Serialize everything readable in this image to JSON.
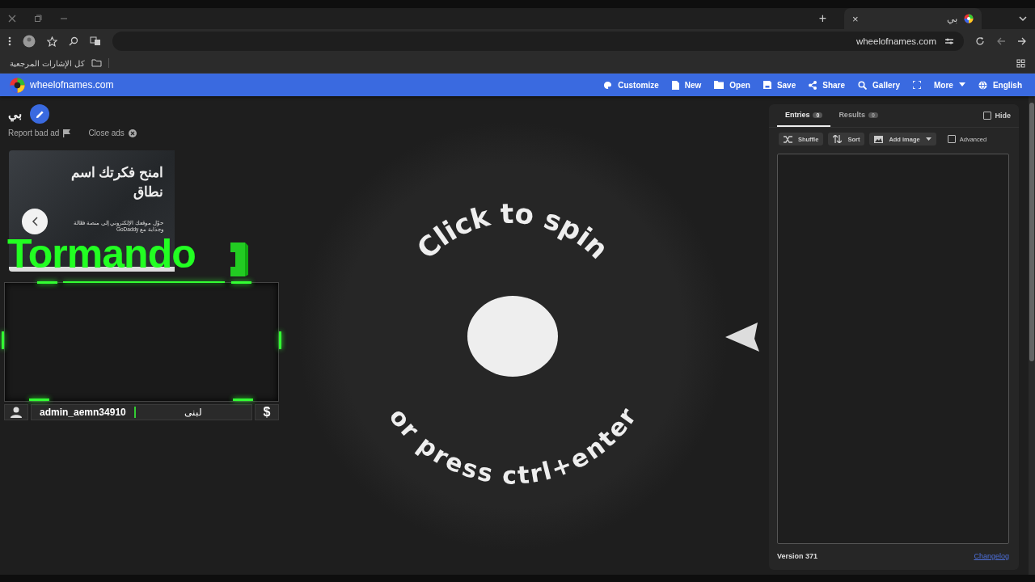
{
  "browser": {
    "tab_title": "بي",
    "new_tab": "+",
    "tab_close": "×",
    "url": "wheelofnames.com",
    "bookmarks": "كل الإشارات المرجعية"
  },
  "nav": {
    "site": "wheelofnames.com",
    "items": [
      {
        "label": "Customize"
      },
      {
        "label": "New"
      },
      {
        "label": "Open"
      },
      {
        "label": "Save"
      },
      {
        "label": "Share"
      },
      {
        "label": "Gallery"
      },
      {
        "label": "More"
      },
      {
        "label": "English"
      }
    ]
  },
  "wheel_name": "بي",
  "ad": {
    "report": "Report bad ad",
    "close": "Close ads",
    "headline": "امنح فكرتك اسم نطاق",
    "body": "حوّل موقعك الإلكتروني إلى منصة فعّالة وجذابة مع GoDaddy"
  },
  "overlay": {
    "title": "Tormando",
    "user": "admin_aemn34910",
    "name": "لبنى",
    "currency": "$"
  },
  "wheel": {
    "top_text": "Click to spin",
    "bottom_text": "or press ctrl+enter"
  },
  "panel": {
    "tabs": [
      {
        "label": "Entries",
        "count": "0",
        "selected": true
      },
      {
        "label": "Results",
        "count": "0",
        "selected": false
      }
    ],
    "hide": {
      "label": "Hide",
      "checked": false
    },
    "tools": [
      "Shuffle",
      "Sort",
      "Add image"
    ],
    "advanced": {
      "label": "Advanced",
      "checked": false
    },
    "version": "Version 371",
    "changelog": "Changelog"
  }
}
